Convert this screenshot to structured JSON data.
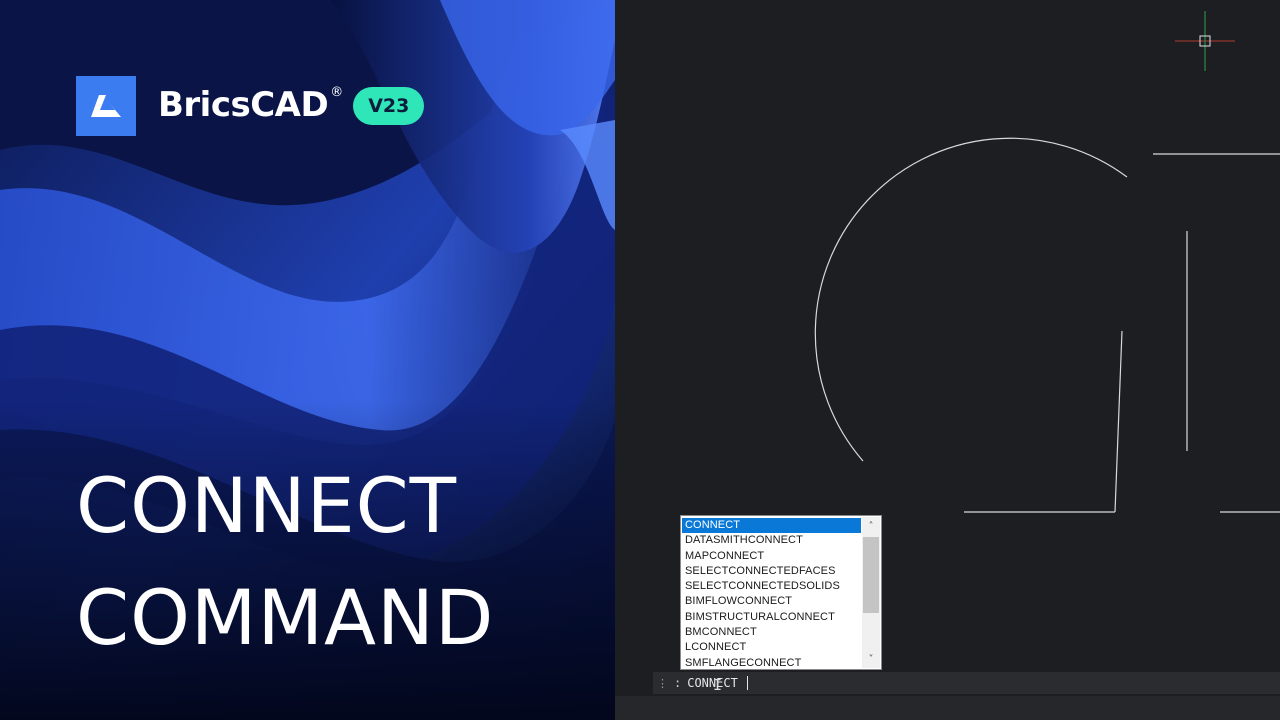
{
  "brand": {
    "name": "BricsCAD",
    "registered_mark": "®",
    "version": "V23",
    "logo_color": "#3b7cf0",
    "badge_color": "#2ee6b8",
    "logo_icon": "bricscad-logo-icon"
  },
  "headline": {
    "line1": "CONNECT",
    "line2": "COMMAND"
  },
  "autocomplete": {
    "items": [
      "CONNECT",
      "DATASMITHCONNECT",
      "MAPCONNECT",
      "SELECTCONNECTEDFACES",
      "SELECTCONNECTEDSOLIDS",
      "BIMFLOWCONNECT",
      "BIMSTRUCTURALCONNECT",
      "BMCONNECT",
      "LCONNECT",
      "SMFLANGECONNECT"
    ],
    "selected_index": 0,
    "scroll_up_icon": "chevron-up-icon",
    "scroll_down_icon": "chevron-down-icon",
    "selection_color": "#0a78d7"
  },
  "command_line": {
    "prompt": ":",
    "value": "CONNECT"
  },
  "viewport": {
    "background": "#1c1e22",
    "geometry_color": "#d9d9d9",
    "ucs_x_axis_color": "#c0392b",
    "ucs_y_axis_color": "#27ae60"
  }
}
